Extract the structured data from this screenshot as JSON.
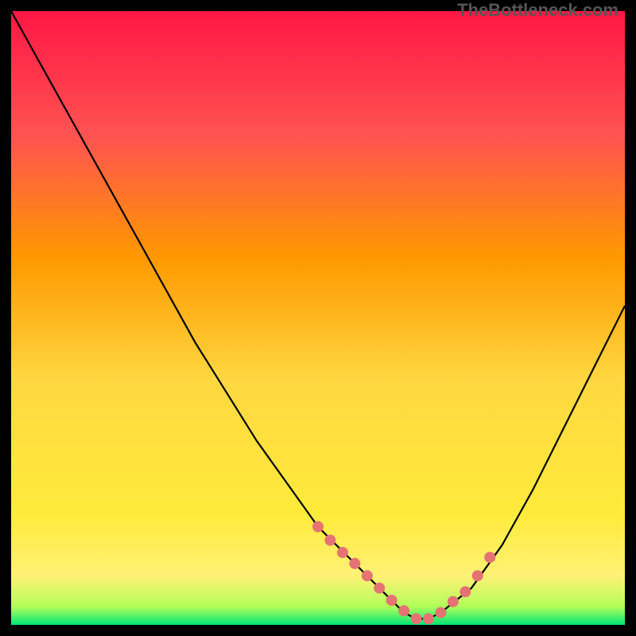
{
  "watermark": "TheBottleneck.com",
  "chart_data": {
    "type": "line",
    "title": "",
    "xlabel": "",
    "ylabel": "",
    "xlim": [
      0,
      100
    ],
    "ylim": [
      0,
      100
    ],
    "gradient_stops": [
      {
        "offset": 0,
        "color": "#FF1744"
      },
      {
        "offset": 20,
        "color": "#FF5252"
      },
      {
        "offset": 40,
        "color": "#FF9800"
      },
      {
        "offset": 60,
        "color": "#FFD740"
      },
      {
        "offset": 82,
        "color": "#FFEB3B"
      },
      {
        "offset": 92,
        "color": "#FFF176"
      },
      {
        "offset": 97,
        "color": "#B2FF59"
      },
      {
        "offset": 100,
        "color": "#00E676"
      }
    ],
    "series": [
      {
        "name": "curve",
        "x": [
          0,
          5,
          10,
          15,
          20,
          25,
          30,
          35,
          40,
          45,
          50,
          55,
          60,
          62,
          64,
          66,
          68,
          70,
          75,
          80,
          85,
          90,
          95,
          100
        ],
        "y": [
          100,
          91,
          82,
          73,
          64,
          55,
          46,
          38,
          30,
          23,
          16,
          11,
          6,
          4,
          2,
          1,
          1,
          2,
          6,
          13,
          22,
          32,
          42,
          52
        ]
      }
    ],
    "markers": {
      "name": "dots",
      "x": [
        50,
        52,
        54,
        56,
        58,
        60,
        62,
        64,
        66,
        68,
        70,
        72,
        74,
        76,
        78
      ],
      "y": [
        16,
        13.8,
        11.8,
        10,
        8,
        6,
        4,
        2.3,
        1,
        1,
        2,
        3.8,
        5.4,
        8,
        11
      ],
      "color": "#E57373",
      "radius": 7
    }
  }
}
